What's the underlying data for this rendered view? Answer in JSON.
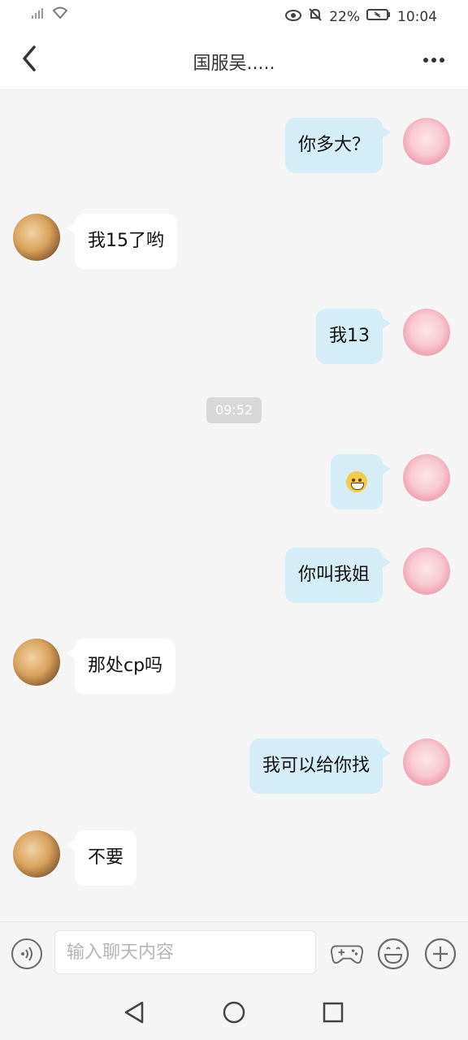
{
  "status_bar": {
    "battery": "22%",
    "time": "10:04",
    "icons": [
      "signal-icon",
      "wifi-icon",
      "eye-icon",
      "mute-icon",
      "battery-icon"
    ]
  },
  "header": {
    "title": "国服吴.....",
    "back_icon": "back-icon",
    "more_icon": "more-icon"
  },
  "messages": [
    {
      "from": "me",
      "text": "你多大？"
    },
    {
      "from": "them",
      "text": "我15了哟"
    },
    {
      "from": "me",
      "text": "我13"
    },
    {
      "timestamp": "09:52"
    },
    {
      "from": "me",
      "emoji": "sweat-smile-emoji"
    },
    {
      "from": "me",
      "text": "你叫我姐"
    },
    {
      "from": "them",
      "text": "那处cp吗"
    },
    {
      "from": "me",
      "text": "我可以给你找"
    },
    {
      "from": "them",
      "text": "不要"
    }
  ],
  "input_bar": {
    "placeholder": "输入聊天内容",
    "icons": [
      "voice-icon",
      "game-controller-icon",
      "emoji-icon",
      "plus-icon"
    ]
  },
  "nav_bar": {
    "icons": [
      "nav-back-icon",
      "nav-home-icon",
      "nav-recents-icon"
    ]
  }
}
